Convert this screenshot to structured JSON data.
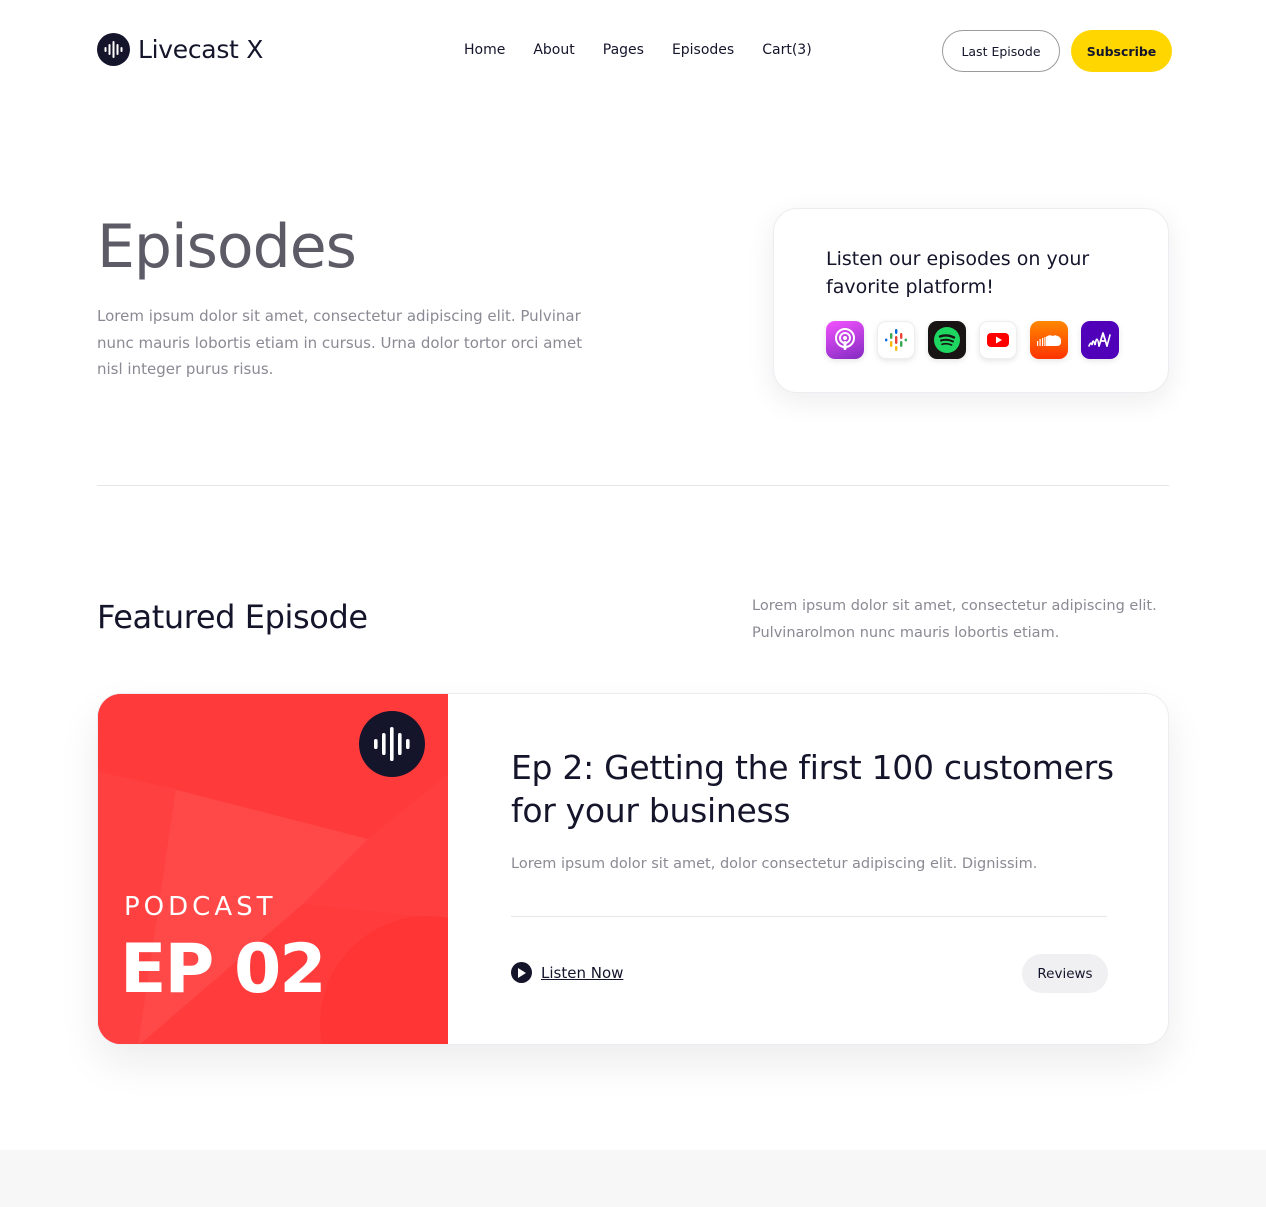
{
  "header": {
    "logo_text": "Livecast X",
    "nav": [
      "Home",
      "About",
      "Pages",
      "Episodes",
      "Cart(3)"
    ],
    "last_episode_label": "Last Episode",
    "subscribe_label": "Subscribe"
  },
  "hero": {
    "title": "Episodes",
    "description": "Lorem ipsum dolor sit amet, consectetur adipiscing elit. Pulvinar nunc mauris lobortis etiam in cursus. Urna dolor tortor orci amet nisl integer purus risus."
  },
  "platform_card": {
    "heading": "Listen our episodes on your favorite platform!",
    "platforms": [
      "apple-podcasts-icon",
      "google-podcasts-icon",
      "spotify-icon",
      "youtube-icon",
      "soundcloud-icon",
      "anchor-icon"
    ]
  },
  "featured": {
    "title": "Featured Episode",
    "description": "Lorem ipsum dolor sit amet, consectetur adipiscing elit. Pulvinarolmon nunc mauris lobortis etiam."
  },
  "episode": {
    "cover_label": "PODCAST",
    "cover_number": "EP 02",
    "title": "Ep 2: Getting the first 100 customers for your business",
    "description": "Lorem ipsum dolor sit amet, dolor consectetur adipiscing elit. Dignissim.",
    "listen_label": "Listen Now",
    "reviews_label": "Reviews"
  },
  "colors": {
    "accent_yellow": "#ffd600",
    "cover_red": "#ff3b3b",
    "dark": "#14142b"
  }
}
